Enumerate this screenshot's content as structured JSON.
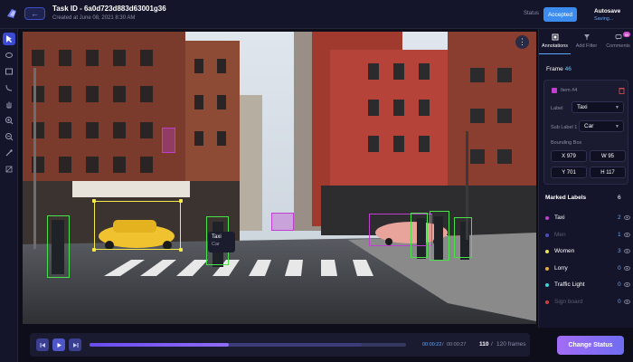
{
  "header": {
    "task_title": "Task ID - 6a0d723d883d63001g36",
    "created": "Created at June 08, 2021 8:30 AM",
    "status_label": "Status",
    "status_value": "Accepted",
    "autosave_label": "Autosave",
    "saving_label": "Saving..."
  },
  "toolbar": {
    "tools": [
      "pointer-icon",
      "polygon-icon",
      "rectangle-icon",
      "line-icon",
      "pan-hand-icon",
      "zoom-in-icon",
      "zoom-out-icon",
      "eyedropper-icon",
      "hide-icon"
    ]
  },
  "canvas": {
    "tooltip_label": "Taxi",
    "tooltip_sublabel": "Car",
    "more_icon": "more-vertical-icon"
  },
  "player": {
    "current_time": "00:00:22",
    "separator": "/",
    "total_time": "00:00:27",
    "current_frame": "110",
    "frame_separator": "/",
    "total_frames": "120 frames",
    "progress": 0.44,
    "buffered": 0.86
  },
  "change_status_label": "Change Status",
  "panel": {
    "tabs": [
      {
        "label": "Annotations",
        "icon": "annotations-icon",
        "active": true
      },
      {
        "label": "Add Filter",
        "icon": "filter-icon",
        "active": false
      },
      {
        "label": "Comments",
        "icon": "comments-icon",
        "active": false,
        "badge": "99"
      }
    ],
    "frame_label": "Frame",
    "frame_number": "46",
    "item": {
      "name": "Item #4",
      "label_field": "Label",
      "label_value": "Taxi",
      "sublabel_field": "Sub Label 1",
      "sublabel_value": "Car",
      "bbox_field": "Bounding Box",
      "x": "X 979",
      "w": "W 95",
      "y": "Y 701",
      "h": "H 117"
    },
    "marked_labels_title": "Marked Labels",
    "marked_labels_count": "6",
    "labels": [
      {
        "name": "Taxi",
        "count": "2",
        "color": "#c03fd0",
        "dim": false
      },
      {
        "name": "Men",
        "count": "1",
        "color": "#4a4cc0",
        "dim": true
      },
      {
        "name": "Women",
        "count": "3",
        "color": "#e8e35a",
        "dim": false
      },
      {
        "name": "Lorry",
        "count": "0",
        "color": "#e7a93a",
        "dim": false
      },
      {
        "name": "Traffic Light",
        "count": "0",
        "color": "#3fd0d8",
        "dim": false
      },
      {
        "name": "Sign board",
        "count": "0",
        "color": "#d03f3f",
        "dim": true
      }
    ]
  },
  "colors": {
    "accent_blue": "#3c8cf0",
    "accent_purple": "#7a5cf2",
    "box_green": "#49e04a",
    "box_yellow": "#f6e94a",
    "box_purple": "#c03fd0"
  }
}
